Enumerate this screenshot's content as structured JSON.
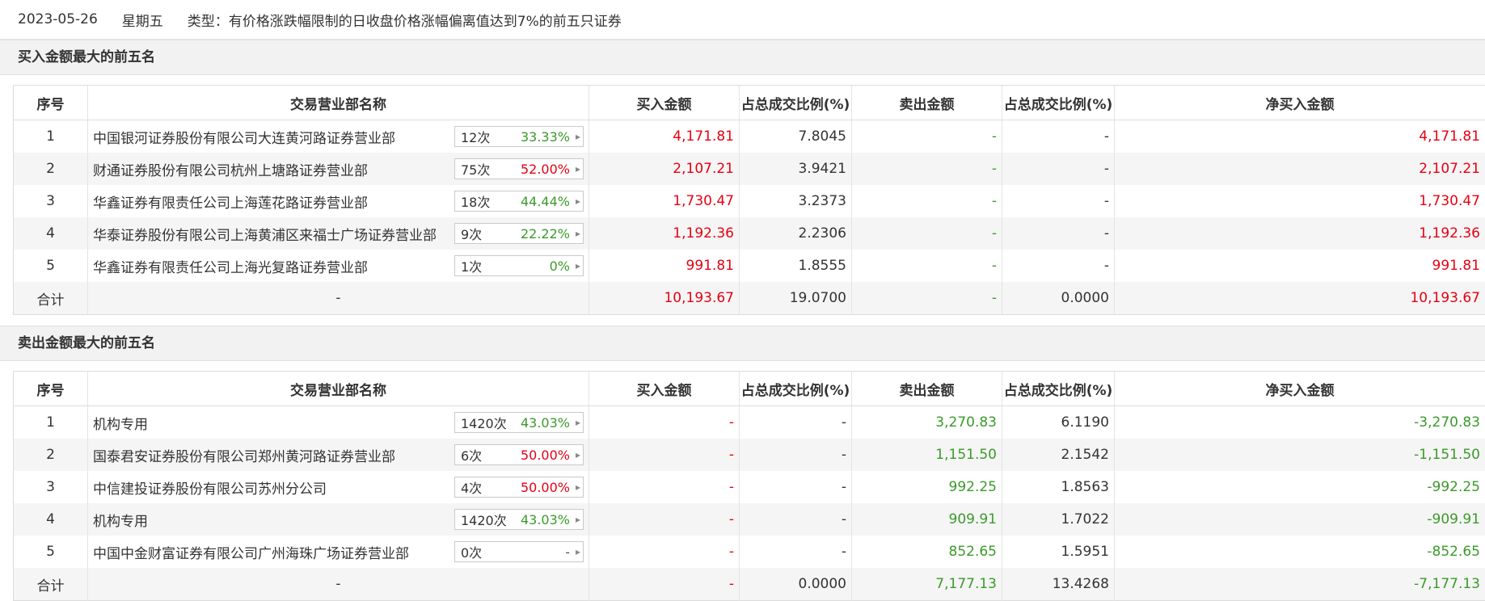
{
  "header": {
    "date": "2023-05-26",
    "weekday": "星期五",
    "type_text": "类型：有价格涨跌幅限制的日收盘价格涨幅偏离值达到7%的前五只证券"
  },
  "columns": [
    "序号",
    "交易营业部名称",
    "买入金额",
    "占总成交比例(%)",
    "卖出金额",
    "占总成交比例(%)",
    "净买入金额"
  ],
  "colors": {
    "up": "#e60012",
    "down": "#3a9a2a",
    "section_bg": "#f2f2f2"
  },
  "buy_section": {
    "title": "买入金额最大的前五名",
    "rows": [
      {
        "idx": "1",
        "name": "中国银河证券股份有限公司大连黄河路证券营业部",
        "times": "12次",
        "rate": "33.33%",
        "rate_color": "green",
        "buy": "4,171.81",
        "buy_ratio": "7.8045",
        "sell": "-",
        "sell_ratio": "-",
        "net": "4,171.81",
        "net_color": "red"
      },
      {
        "idx": "2",
        "name": "财通证券股份有限公司杭州上塘路证券营业部",
        "times": "75次",
        "rate": "52.00%",
        "rate_color": "red",
        "buy": "2,107.21",
        "buy_ratio": "3.9421",
        "sell": "-",
        "sell_ratio": "-",
        "net": "2,107.21",
        "net_color": "red"
      },
      {
        "idx": "3",
        "name": "华鑫证券有限责任公司上海莲花路证券营业部",
        "times": "18次",
        "rate": "44.44%",
        "rate_color": "green",
        "buy": "1,730.47",
        "buy_ratio": "3.2373",
        "sell": "-",
        "sell_ratio": "-",
        "net": "1,730.47",
        "net_color": "red"
      },
      {
        "idx": "4",
        "name": "华泰证券股份有限公司上海黄浦区来福士广场证券营业部",
        "times": "9次",
        "rate": "22.22%",
        "rate_color": "green",
        "buy": "1,192.36",
        "buy_ratio": "2.2306",
        "sell": "-",
        "sell_ratio": "-",
        "net": "1,192.36",
        "net_color": "red"
      },
      {
        "idx": "5",
        "name": "华鑫证券有限责任公司上海光复路证券营业部",
        "times": "1次",
        "rate": "0%",
        "rate_color": "green",
        "buy": "991.81",
        "buy_ratio": "1.8555",
        "sell": "-",
        "sell_ratio": "-",
        "net": "991.81",
        "net_color": "red"
      }
    ],
    "total": {
      "label": "合计",
      "name": "-",
      "buy": "10,193.67",
      "buy_ratio": "19.0700",
      "sell": "-",
      "sell_ratio": "0.0000",
      "net": "10,193.67",
      "net_color": "red"
    }
  },
  "sell_section": {
    "title": "卖出金额最大的前五名",
    "rows": [
      {
        "idx": "1",
        "name": "机构专用",
        "times": "1420次",
        "rate": "43.03%",
        "rate_color": "green",
        "buy": "-",
        "buy_ratio": "-",
        "sell": "3,270.83",
        "sell_ratio": "6.1190",
        "net": "-3,270.83",
        "net_color": "green"
      },
      {
        "idx": "2",
        "name": "国泰君安证券股份有限公司郑州黄河路证券营业部",
        "times": "6次",
        "rate": "50.00%",
        "rate_color": "red",
        "buy": "-",
        "buy_ratio": "-",
        "sell": "1,151.50",
        "sell_ratio": "2.1542",
        "net": "-1,151.50",
        "net_color": "green"
      },
      {
        "idx": "3",
        "name": "中信建投证券股份有限公司苏州分公司",
        "times": "4次",
        "rate": "50.00%",
        "rate_color": "red",
        "buy": "-",
        "buy_ratio": "-",
        "sell": "992.25",
        "sell_ratio": "1.8563",
        "net": "-992.25",
        "net_color": "green"
      },
      {
        "idx": "4",
        "name": "机构专用",
        "times": "1420次",
        "rate": "43.03%",
        "rate_color": "green",
        "buy": "-",
        "buy_ratio": "-",
        "sell": "909.91",
        "sell_ratio": "1.7022",
        "net": "-909.91",
        "net_color": "green"
      },
      {
        "idx": "5",
        "name": "中国中金财富证券有限公司广州海珠广场证券营业部",
        "times": "0次",
        "rate": "-",
        "rate_color": "gray",
        "buy": "-",
        "buy_ratio": "-",
        "sell": "852.65",
        "sell_ratio": "1.5951",
        "net": "-852.65",
        "net_color": "green"
      }
    ],
    "total": {
      "label": "合计",
      "name": "-",
      "buy": "-",
      "buy_ratio": "0.0000",
      "sell": "7,177.13",
      "sell_ratio": "13.4268",
      "net": "-7,177.13",
      "net_color": "green"
    }
  }
}
